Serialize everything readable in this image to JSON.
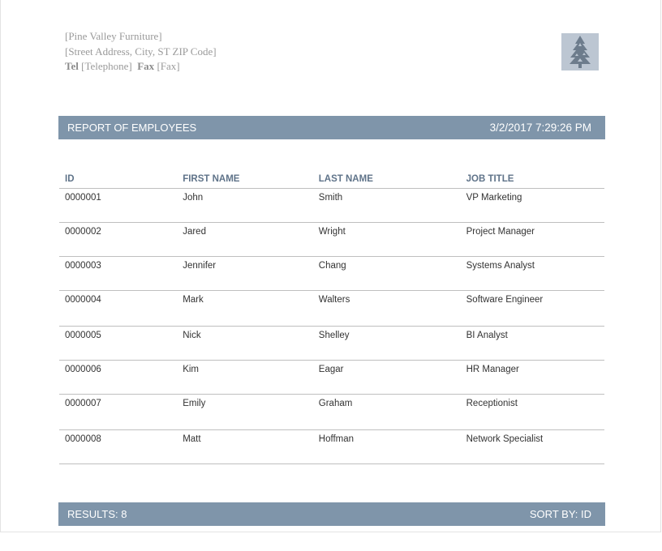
{
  "company": {
    "name": "[Pine Valley Furniture]",
    "address": "[Street Address, City, ST  ZIP Code]",
    "tel_label": "Tel",
    "tel_value": "[Telephone]",
    "fax_label": "Fax",
    "fax_value": "[Fax]",
    "logo_icon": "pine-tree-icon"
  },
  "header": {
    "title": "REPORT OF EMPLOYEES",
    "datetime": "3/2/2017 7:29:26 PM"
  },
  "table": {
    "columns": [
      "ID",
      "FIRST NAME",
      "LAST NAME",
      "JOB TITLE"
    ],
    "rows": [
      [
        "0000001",
        "John",
        "Smith",
        "VP Marketing"
      ],
      [
        "0000002",
        "Jared",
        "Wright",
        "Project Manager"
      ],
      [
        "0000003",
        "Jennifer",
        "Chang",
        "Systems Analyst"
      ],
      [
        "0000004",
        "Mark",
        "Walters",
        "Software Engineer"
      ],
      [
        "0000005",
        "Nick",
        "Shelley",
        "BI Analyst"
      ],
      [
        "0000006",
        "Kim",
        "Eagar",
        "HR Manager"
      ],
      [
        "0000007",
        "Emily",
        "Graham",
        "Receptionist"
      ],
      [
        "0000008",
        "Matt",
        "Hoffman",
        "Network Specialist"
      ]
    ]
  },
  "footer": {
    "results": "RESULTS: 8",
    "sort": "SORT BY: ID"
  },
  "colors": {
    "bar": "#7f95aa",
    "header_text": "#5f7389",
    "logo_bg": "#bcc6d2",
    "logo_tree": "#6d7c8c"
  }
}
